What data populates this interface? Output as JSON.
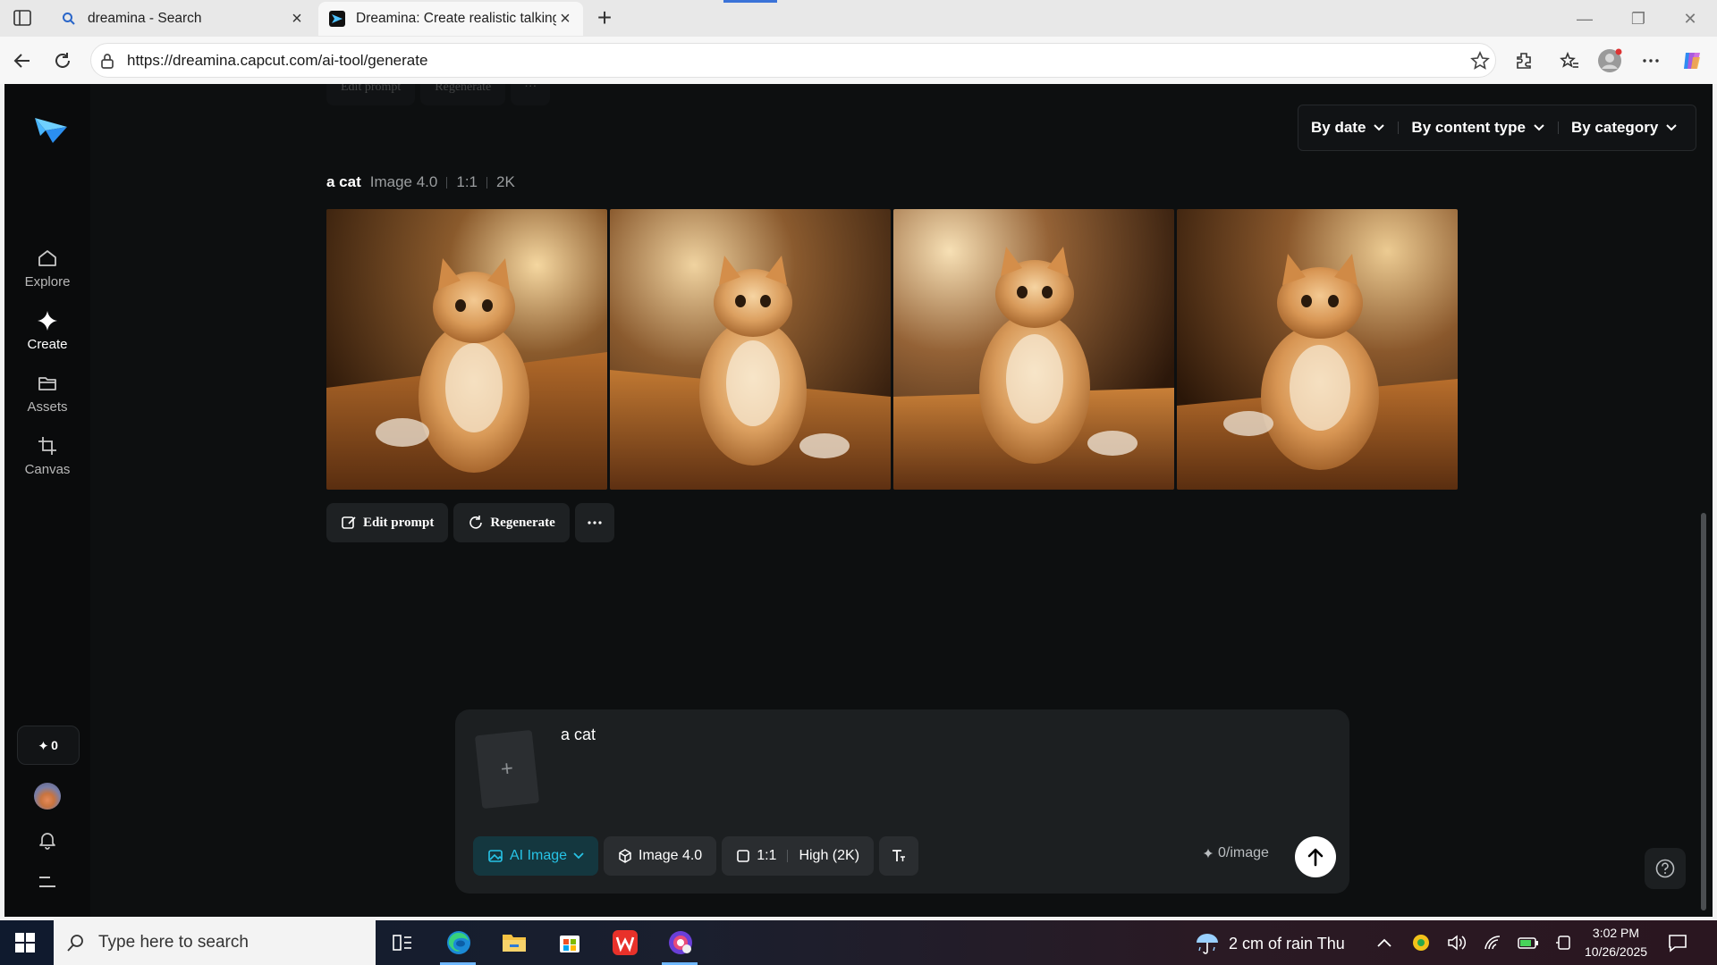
{
  "browser": {
    "tabs": [
      {
        "title": "dreamina - Search",
        "active": false,
        "icon": "search-icon"
      },
      {
        "title": "Dreamina: Create realistic talking",
        "active": true,
        "icon": "dreamina-favicon"
      }
    ],
    "url": "https://dreamina.capcut.com/ai-tool/generate"
  },
  "sidebar": {
    "items": [
      {
        "label": "Explore",
        "icon": "home-icon"
      },
      {
        "label": "Create",
        "icon": "sparkle-icon",
        "active": true
      },
      {
        "label": "Assets",
        "icon": "folder-icon"
      },
      {
        "label": "Canvas",
        "icon": "crop-icon"
      }
    ],
    "credits": "0"
  },
  "ghost_actions": [
    "Edit prompt",
    "Regenerate"
  ],
  "filters": [
    {
      "label": "By date"
    },
    {
      "label": "By content type"
    },
    {
      "label": "By category"
    }
  ],
  "generation": {
    "prompt": "a cat",
    "model": "Image 4.0",
    "ratio": "1:1",
    "resolution": "2K",
    "image_count": 4
  },
  "actions": {
    "edit_prompt": "Edit prompt",
    "regenerate": "Regenerate"
  },
  "composer": {
    "prompt_text": "a cat",
    "mode": "AI Image",
    "model": "Image 4.0",
    "ratio": "1:1",
    "quality": "High (2K)",
    "cost": "0/image"
  },
  "taskbar": {
    "search_placeholder": "Type here to search",
    "weather": "2 cm of rain Thu",
    "time": "3:02 PM",
    "date": "10/26/2025"
  },
  "colors": {
    "accent": "#27c3e6",
    "page_bg": "#0d0f10",
    "panel_bg": "#1c1f21"
  }
}
